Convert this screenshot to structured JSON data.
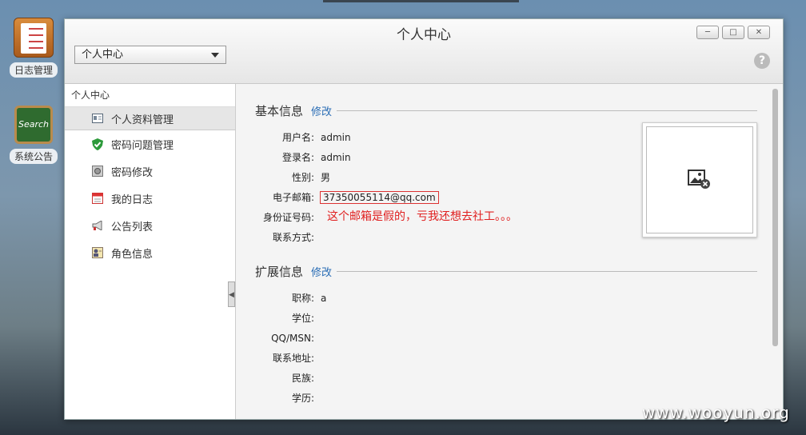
{
  "desktop": {
    "icons": [
      {
        "label": "日志管理",
        "icon": "notepad-icon"
      },
      {
        "label": "系统公告",
        "icon": "chalkboard-icon",
        "icon_text": "Search"
      }
    ]
  },
  "window": {
    "title": "个人中心",
    "dropdown_value": "个人中心",
    "help_glyph": "?",
    "controls": [
      "minimize-icon",
      "maximize-icon",
      "close-icon"
    ]
  },
  "sidebar": {
    "heading": "个人中心",
    "items": [
      {
        "label": "个人资料管理",
        "icon": "profile-card-icon",
        "active": true
      },
      {
        "label": "密码问题管理",
        "icon": "shield-check-icon",
        "active": false
      },
      {
        "label": "密码修改",
        "icon": "safe-icon",
        "active": false
      },
      {
        "label": "我的日志",
        "icon": "calendar-icon",
        "active": false
      },
      {
        "label": "公告列表",
        "icon": "megaphone-icon",
        "active": false
      },
      {
        "label": "角色信息",
        "icon": "role-icon",
        "active": false
      }
    ]
  },
  "basic": {
    "title": "基本信息",
    "edit": "修改",
    "fields": [
      {
        "key": "用户名:",
        "value": "admin"
      },
      {
        "key": "登录名:",
        "value": "admin"
      },
      {
        "key": "性别:",
        "value": "男"
      },
      {
        "key": "电子邮箱:",
        "value": "37350055114@qq.com"
      },
      {
        "key": "身份证号码:",
        "value": ""
      },
      {
        "key": "联系方式:",
        "value": ""
      }
    ],
    "note": "这个邮箱是假的，亏我还想去社工。。。"
  },
  "extended": {
    "title": "扩展信息",
    "edit": "修改",
    "fields": [
      {
        "key": "职称:",
        "value": "a"
      },
      {
        "key": "学位:",
        "value": ""
      },
      {
        "key": "QQ/MSN:",
        "value": ""
      },
      {
        "key": "联系地址:",
        "value": ""
      },
      {
        "key": "民族:",
        "value": ""
      },
      {
        "key": "学历:",
        "value": ""
      }
    ]
  },
  "watermark": "www.wooyun.org",
  "colors": {
    "accent_link": "#2a6db5",
    "annotation_red": "#e02020"
  }
}
